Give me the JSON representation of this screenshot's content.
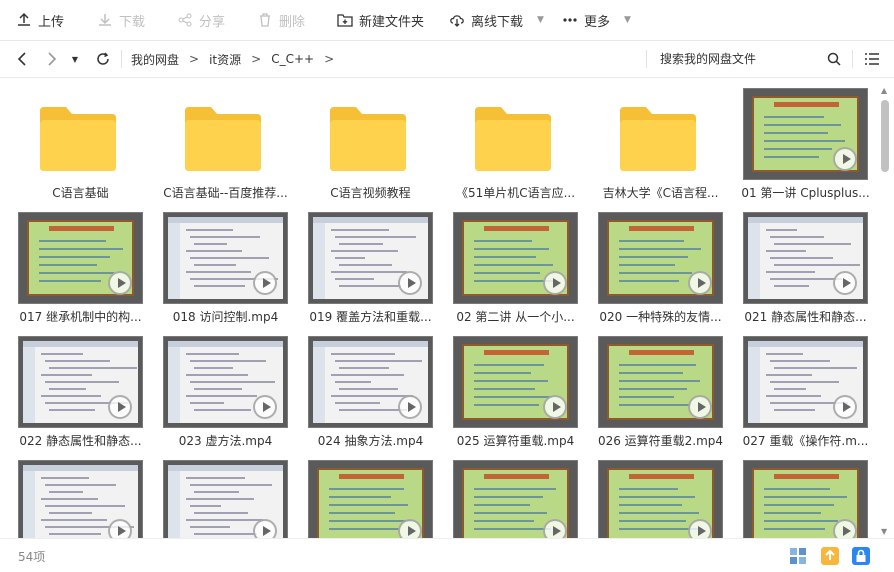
{
  "toolbar": {
    "upload": "上传",
    "download": "下载",
    "share": "分享",
    "delete": "删除",
    "new_folder": "新建文件夹",
    "offline_download": "离线下载",
    "more": "更多"
  },
  "breadcrumb": [
    "我的网盘",
    "it资源",
    "C_C++"
  ],
  "search_label": "搜索我的网盘文件",
  "status": {
    "count": "54项"
  },
  "colors": {
    "folder": "#ffd24d",
    "folder_back": "#f5c035",
    "slide_green": "#b9d987",
    "accent": "#2b86f0",
    "yellow": "#f6b73c"
  },
  "items": [
    {
      "name": "C语言基础",
      "type": "folder"
    },
    {
      "name": "C语言基础--百度推荐...",
      "type": "folder"
    },
    {
      "name": "C语言视频教程",
      "type": "folder"
    },
    {
      "name": "《51单片机C语言应...",
      "type": "folder"
    },
    {
      "name": "吉林大学《C语言程...",
      "type": "folder"
    },
    {
      "name": "01 第一讲 Cplusplus...",
      "type": "video"
    },
    {
      "name": "017 继承机制中的构...",
      "type": "video"
    },
    {
      "name": "018 访问控制.mp4",
      "type": "video"
    },
    {
      "name": "019 覆盖方法和重载...",
      "type": "video"
    },
    {
      "name": "02 第二讲 从一个小...",
      "type": "video"
    },
    {
      "name": "020 一种特殊的友情...",
      "type": "video"
    },
    {
      "name": "021 静态属性和静态...",
      "type": "video"
    },
    {
      "name": "022 静态属性和静态...",
      "type": "video"
    },
    {
      "name": "023 虚方法.mp4",
      "type": "video"
    },
    {
      "name": "024 抽象方法.mp4",
      "type": "video"
    },
    {
      "name": "025 运算符重载.mp4",
      "type": "video"
    },
    {
      "name": "026 运算符重载2.mp4",
      "type": "video"
    },
    {
      "name": "027 重载《操作符.m...",
      "type": "video"
    },
    {
      "name": "",
      "type": "video"
    },
    {
      "name": "",
      "type": "video"
    },
    {
      "name": "",
      "type": "video"
    },
    {
      "name": "",
      "type": "video"
    },
    {
      "name": "",
      "type": "video"
    },
    {
      "name": "",
      "type": "video"
    }
  ]
}
